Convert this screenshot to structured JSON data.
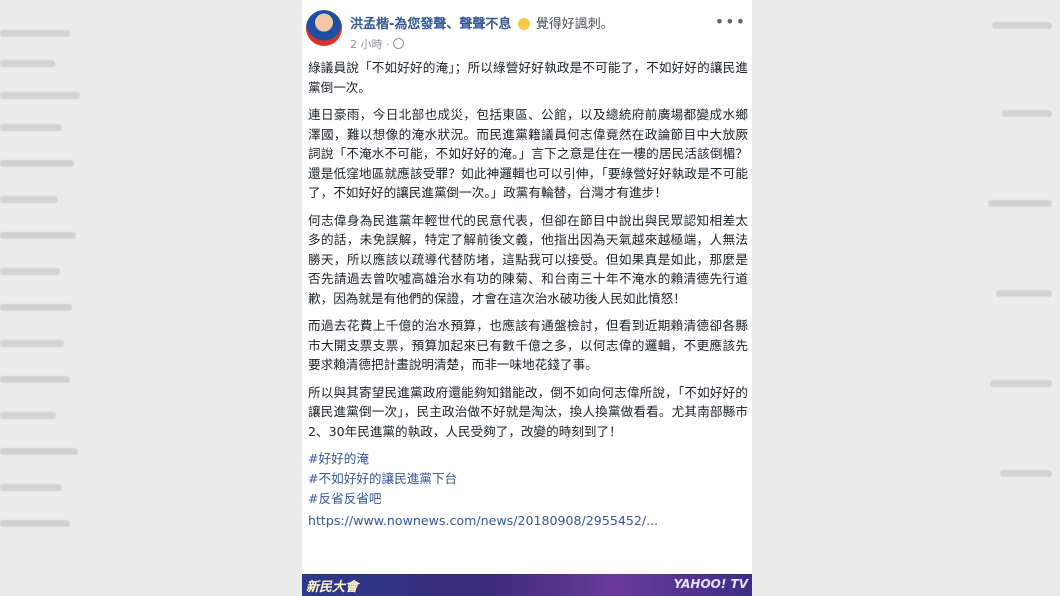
{
  "post": {
    "author": "洪孟楷-為您發聲、聲聲不息",
    "feeling": "覺得好諷刺。",
    "time": "2 小時",
    "more_label": "•••",
    "paragraphs": [
      "綠議員說「不如好好的淹」；所以綠營好好執政是不可能了，不如好好的讓民進黨倒一次。",
      "連日豪雨，今日北部也成災，包括東區、公館，以及總統府前廣場都變成水鄉澤國，難以想像的淹水狀況。而民進黨籍議員何志偉竟然在政論節目中大放厥詞說「不淹水不可能，不如好好的淹。」言下之意是住在一樓的居民活該倒楣？還是低窪地區就應該受罪？如此神邏輯也可以引伸，「要綠營好好執政是不可能了，不如好好的讓民進黨倒一次。」政黨有輪替，台灣才有進步！",
      "何志偉身為民進黨年輕世代的民意代表，但卻在節目中說出與民眾認知相差太多的話，未免誤解，特定了解前後文義，他指出因為天氣越來越極端，人無法勝天，所以應該以疏導代替防堵，這點我可以接受。但如果真是如此，那麼是否先請過去曾吹噓高雄治水有功的陳菊、和台南三十年不淹水的賴清德先行道歉，因為就是有他們的保證，才會在這次治水破功後人民如此憤怒！",
      "而過去花費上千億的治水預算，也應該有通盤檢討，但看到近期賴清德卻各縣市大開支票支票，預算加起來已有數千億之多，以何志偉的邏輯，不更應該先要求賴清德把計畫說明清楚，而非一味地花錢了事。",
      "所以與其寄望民進黨政府還能夠知錯能改，倒不如向何志偉所說，「不如好好的讓民進黨倒一次」，民主政治做不好就是淘汰，換人換黨做看看。尤其南部縣市2、30年民進黨的執政，人民受夠了，改變的時刻到了！"
    ],
    "hashtags": [
      "#好好的淹",
      "#不如好好的讓民進黨下台",
      "#反省反省吧"
    ],
    "link": "https://www.nownews.com/news/20180908/2955452/..."
  },
  "video": {
    "left_text": "新民大會",
    "right_text": "YAHOO! TV"
  }
}
